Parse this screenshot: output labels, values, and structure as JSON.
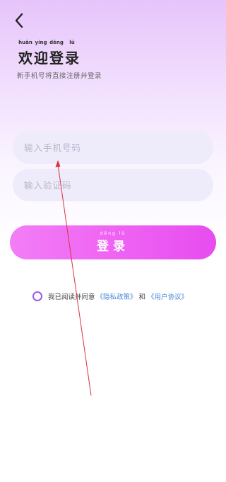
{
  "header": {
    "back_icon": "chevron-left-icon",
    "title_pinyin": [
      "huān",
      "yíng",
      "dēng",
      "lù"
    ],
    "title": "欢迎登录",
    "subtitle": "新手机号将直接注册并登录"
  },
  "form": {
    "phone_placeholder": "输入手机号码",
    "code_placeholder": "输入验证码",
    "login_pinyin": "dēng lù",
    "login_label": "登录"
  },
  "agreement": {
    "prefix": "我已阅读并同意",
    "privacy_link": "《隐私政策》",
    "and": "和",
    "user_link": "《用户协议》"
  },
  "colors": {
    "accent": "#ef64f3",
    "link": "#4a86d8",
    "radio": "#9b5de0"
  }
}
